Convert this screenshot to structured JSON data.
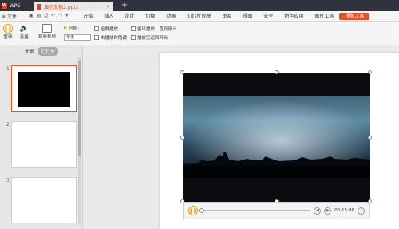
{
  "titlebar": {
    "app_name": "WPS",
    "doc_tab_label": "演示文稿2.pptx",
    "close_glyph": "×",
    "new_tab_glyph": "+"
  },
  "ribbon_tabs": {
    "file_menu": "文件",
    "tabs": [
      "开始",
      "插入",
      "设计",
      "切换",
      "动画",
      "幻灯片放映",
      "审阅",
      "视图",
      "安全",
      "特色应用",
      "图片工具",
      "视频工具"
    ]
  },
  "ribbon": {
    "pause_label": "暂停",
    "volume_label": "音量",
    "crop_label": "裁剪视频",
    "start_label": "开始:",
    "start_value": "单击",
    "options": [
      "全屏播放",
      "未播放时隐藏",
      "循环播放，直到停止",
      "播放完返回开头"
    ]
  },
  "left_panel": {
    "tab_outline": "大纲",
    "tab_slides": "幻灯片",
    "slide_numbers": [
      "1",
      "2",
      "3"
    ]
  },
  "player": {
    "time": "00:15:86"
  },
  "colors": {
    "accent": "#e0522b",
    "play_accent": "#e4a21c",
    "titlebar": "#2f313d"
  }
}
